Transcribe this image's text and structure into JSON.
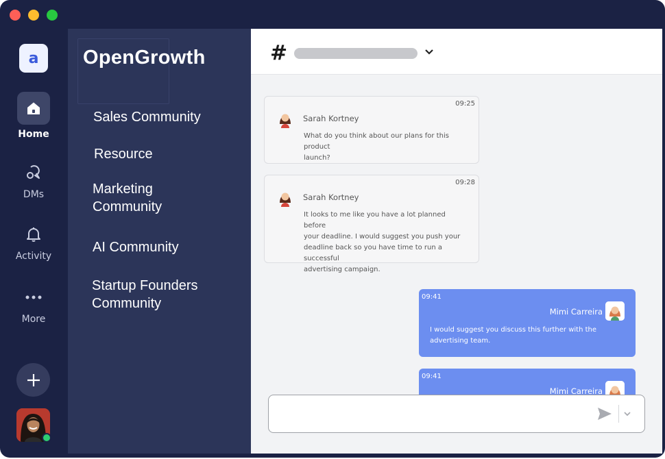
{
  "window": {
    "traffic_lights": [
      "#fe5f57",
      "#febc2e",
      "#28c840"
    ]
  },
  "rail": {
    "logo_letter": "a",
    "items": [
      {
        "label": "Home",
        "icon": "home-icon",
        "active": true
      },
      {
        "label": "DMs",
        "icon": "dms-icon",
        "active": false
      },
      {
        "label": "Activity",
        "icon": "bell-icon",
        "active": false
      },
      {
        "label": "More",
        "icon": "more-icon",
        "active": false
      }
    ],
    "add_icon": "plus-icon",
    "status_color": "#2ecc71"
  },
  "workspace": {
    "name": "OpenGrowth",
    "channels": [
      {
        "lines": [
          "Sales Community"
        ]
      },
      {
        "lines": [
          "Resource"
        ]
      },
      {
        "lines": [
          "Marketing",
          "Community"
        ]
      },
      {
        "lines": [
          "AI Community"
        ]
      },
      {
        "lines": [
          "Startup Founders",
          "Community"
        ]
      }
    ]
  },
  "channel_header": {
    "hash": "#",
    "chevron_icon": "chevron-down-icon"
  },
  "messages": [
    {
      "time": "09:25",
      "sender": "Sarah Kortney",
      "lines": [
        "What do you think about our plans for this product",
        "launch?"
      ],
      "direction": "in"
    },
    {
      "time": "09:28",
      "sender": "Sarah Kortney",
      "lines": [
        "It looks to me like you have a lot planned before",
        "your deadline. I would suggest you push your",
        "deadline back so you have time to run a successful",
        "advertising campaign."
      ],
      "direction": "in"
    },
    {
      "time": "09:41",
      "sender": "Mimi Carreira",
      "lines": [
        "I would suggest you discuss this further with the",
        "advertising team."
      ],
      "direction": "out"
    },
    {
      "time": "09:41",
      "sender": "Mimi Carreira",
      "lines": [],
      "direction": "out"
    }
  ],
  "composer": {
    "value": "",
    "placeholder": "",
    "send_icon": "send-icon",
    "options_icon": "chevron-down-icon"
  },
  "colors": {
    "sidebar": "#1b2244",
    "channel_panel": "#2c3559",
    "outgoing_bubble": "#6c8ef0",
    "main_bg": "#f2f3f5"
  }
}
